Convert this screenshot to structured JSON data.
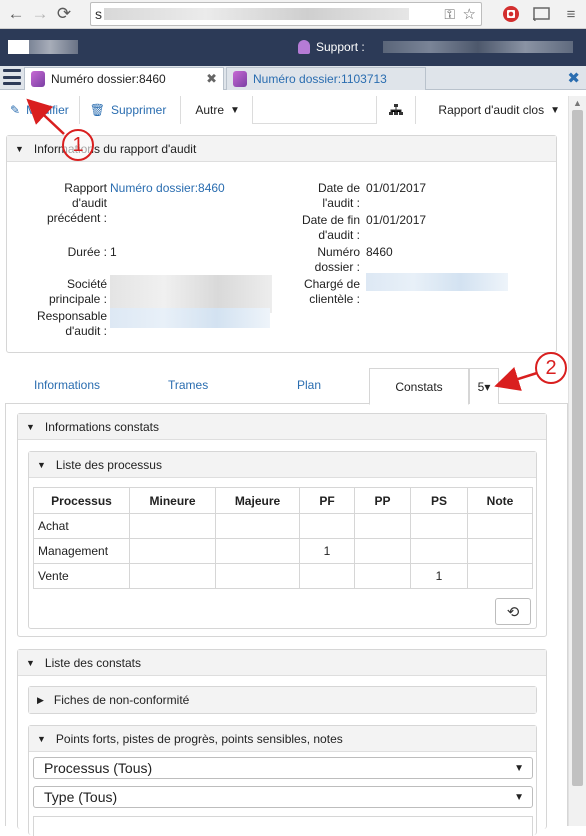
{
  "browser": {
    "url_prefix": "s",
    "icons": [
      "back-icon",
      "forward-icon",
      "reload-icon",
      "key-icon",
      "star-icon",
      "stop-icon",
      "cast-icon",
      "menu-icon"
    ]
  },
  "app": {
    "support_label": "Support :"
  },
  "tabs": [
    {
      "label": "Numéro dossier:8460",
      "active": true
    },
    {
      "label": "Numéro dossier:1103713",
      "active": false
    }
  ],
  "toolbar": {
    "modifier": "Modifier",
    "supprimer": "Supprimer",
    "autre": "Autre",
    "rapport": "Rapport d'audit clos"
  },
  "info_panel": {
    "title": "Informations du rapport d'audit",
    "rapport_label": "Rapport d'audit précédent :",
    "rapport_label_lines": [
      "Rapport",
      "d'audit",
      "précédent :"
    ],
    "rapport_value": "Numéro dossier:8460",
    "duree_label": "Durée :",
    "duree_value": "1",
    "societe_label_lines": [
      "Société",
      "principale :"
    ],
    "responsable_label_lines": [
      "Responsable",
      "d'audit :"
    ],
    "date_debut_label_lines": [
      "Date de",
      "l'audit :"
    ],
    "date_debut_value": "01/01/2017",
    "date_fin_label_lines": [
      "Date de fin",
      "d'audit :"
    ],
    "date_fin_value": "01/01/2017",
    "numero_label_lines": [
      "Numéro",
      "dossier :"
    ],
    "numero_value": "8460",
    "charge_label_lines": [
      "Chargé de",
      "clientèle :"
    ]
  },
  "section_tabs": {
    "informations": "Informations",
    "trames": "Trames",
    "plan": "Plan",
    "constats": "Constats",
    "more": "5▾"
  },
  "constats": {
    "info_title": "Informations constats",
    "liste_processus_title": "Liste des processus",
    "table": {
      "headers": [
        "Processus",
        "Mineure",
        "Majeure",
        "PF",
        "PP",
        "PS",
        "Note"
      ],
      "rows": [
        [
          "Achat",
          "",
          "",
          "",
          "",
          "",
          ""
        ],
        [
          "Management",
          "",
          "",
          "1",
          "",
          "",
          ""
        ],
        [
          "Vente",
          "",
          "",
          "",
          "",
          "1",
          ""
        ]
      ]
    },
    "liste_constats_title": "Liste des constats",
    "fiches_title": "Fiches de non-conformité",
    "points_title": "Points forts, pistes de progrès, points sensibles, notes",
    "select_processus": "Processus (Tous)",
    "select_type": "Type (Tous)"
  },
  "annotations": [
    "1",
    "2"
  ],
  "colors": {
    "header_bg": "#2c3a57",
    "link": "#2a6db0",
    "annotation": "#d91f1f"
  }
}
